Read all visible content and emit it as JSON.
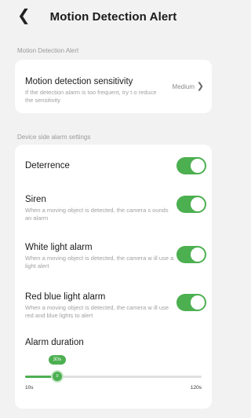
{
  "header": {
    "title": "Motion Detection Alert",
    "back_icon": "chevron-left-icon"
  },
  "sections": {
    "motion": "Motion Detection Alert",
    "device": "Device side alarm settings"
  },
  "sensitivity": {
    "title": "Motion detection sensitivity",
    "description": "If the detection alarm is too frequent, try t o reduce the sensitivity",
    "value": "Medium"
  },
  "alarm_items": [
    {
      "title": "Deterrence",
      "description": "",
      "enabled": true
    },
    {
      "title": "Siren",
      "description": "When a moving object is detected, the camera s ounds an alarm",
      "enabled": true
    },
    {
      "title": "White light alarm",
      "description": "When a moving object is detected, the camera w ill use a light alert",
      "enabled": true
    },
    {
      "title": "Red blue light alarm",
      "description": "When a moving object is detected, the camera w ill use red and blue lights to alert",
      "enabled": true
    }
  ],
  "duration": {
    "title": "Alarm duration",
    "value_label": "30s",
    "min_label": "10s",
    "max_label": "120s",
    "min": 10,
    "max": 120,
    "value": 30
  },
  "colors": {
    "accent": "#4caf50",
    "background": "#f2f2f2",
    "card": "#ffffff"
  }
}
